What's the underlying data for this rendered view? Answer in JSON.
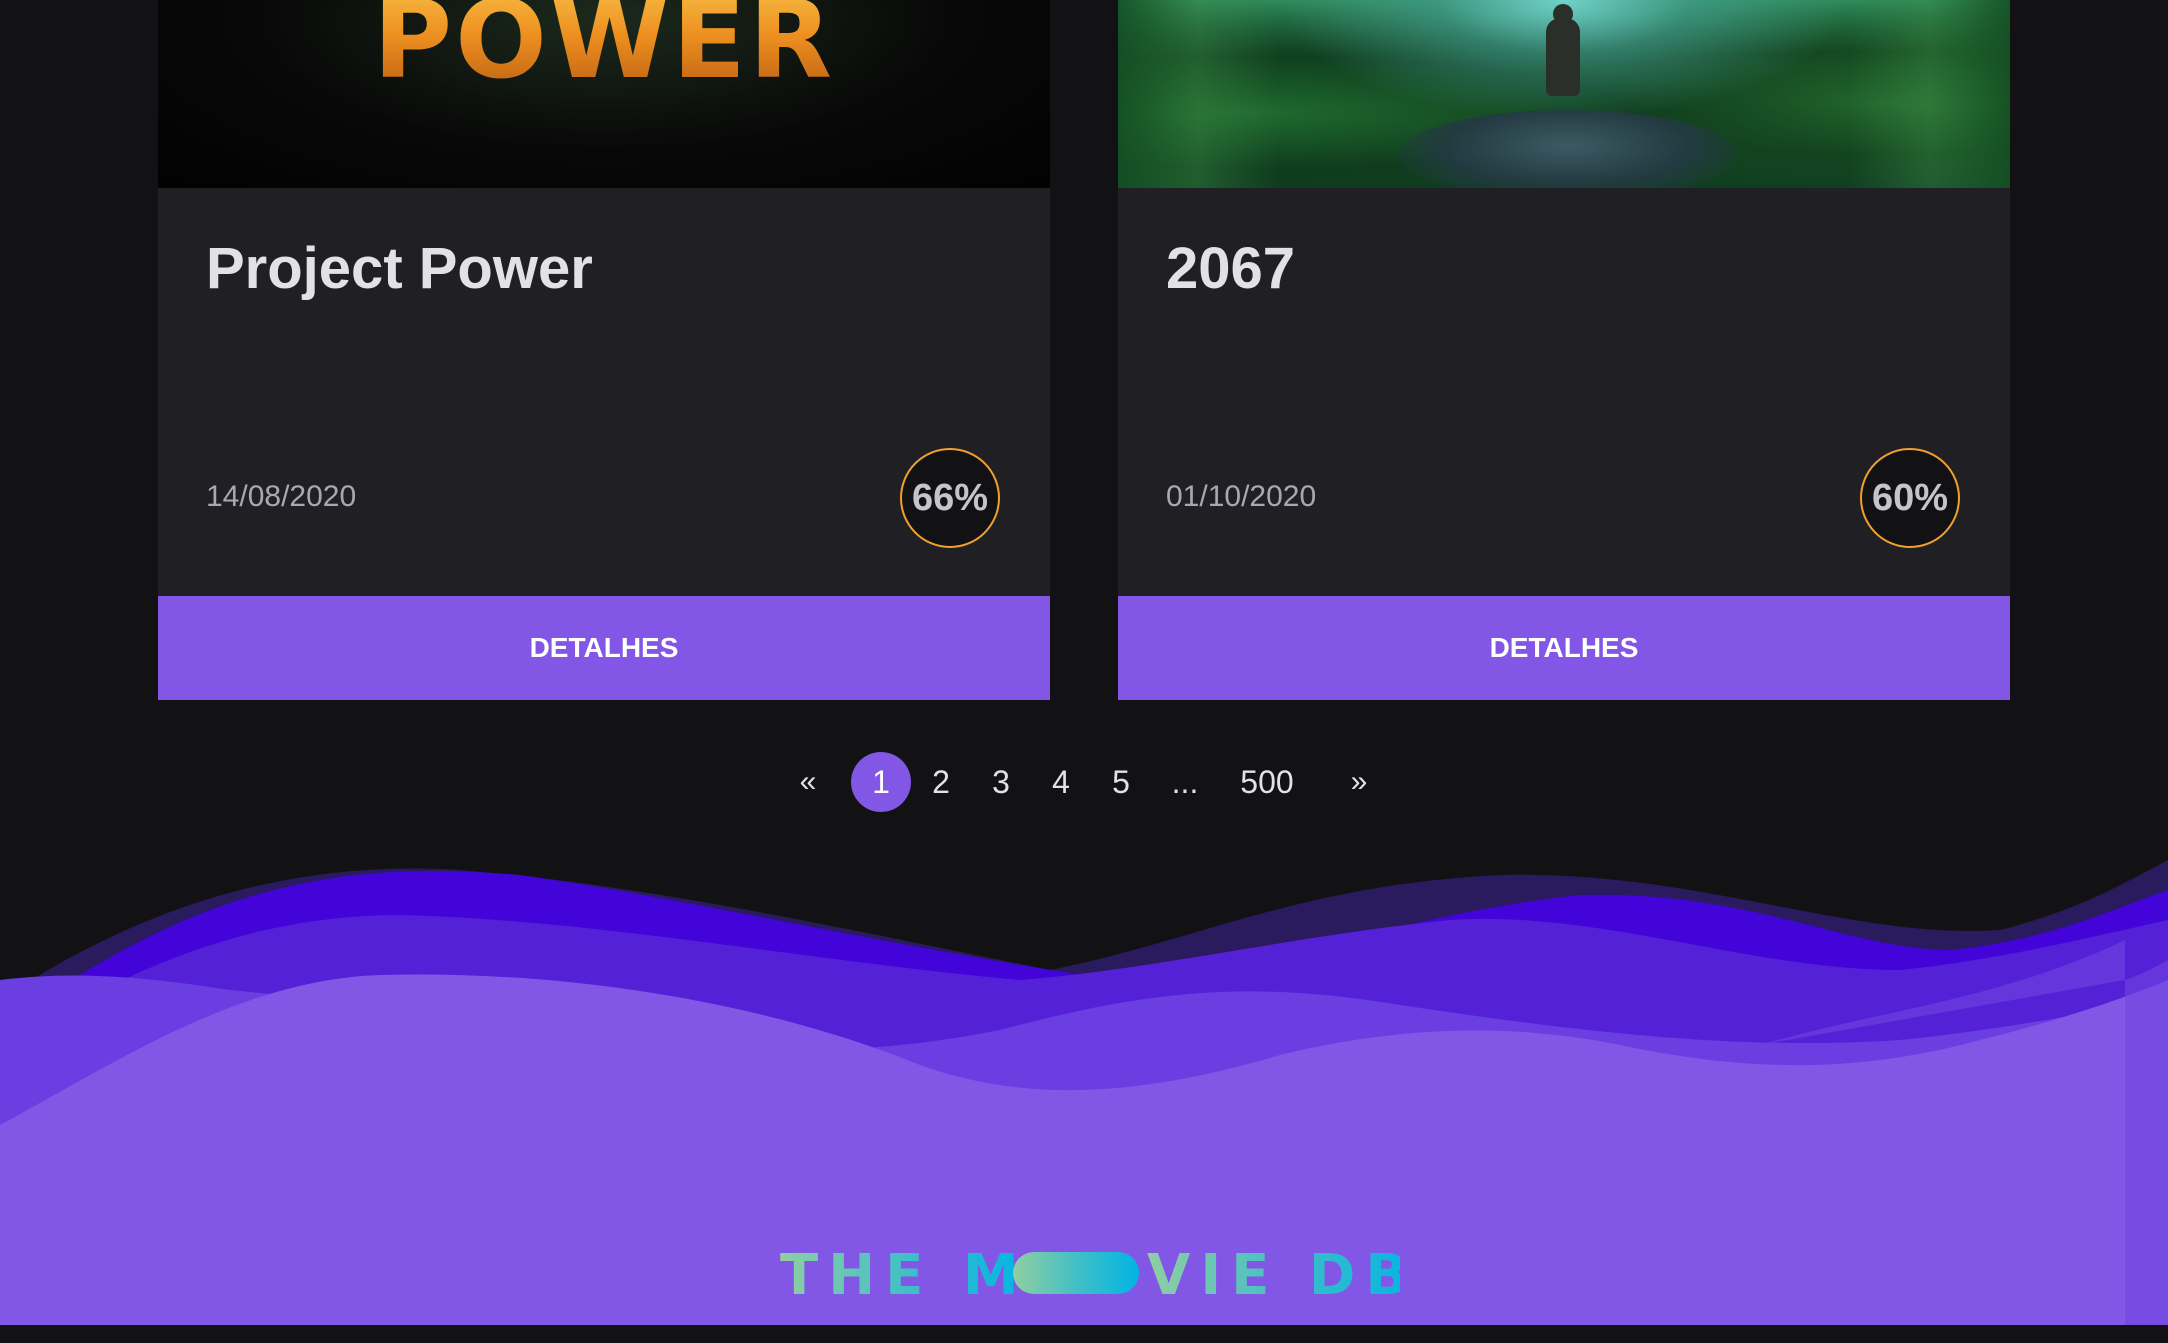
{
  "movies": [
    {
      "poster_text": "POWER",
      "title": "Project Power",
      "date": "14/08/2020",
      "score": "66%",
      "button_label": "DETALHES"
    },
    {
      "title": "2067",
      "date": "01/10/2020",
      "score": "60%",
      "button_label": "DETALHES"
    }
  ],
  "pagination": {
    "prev": "«",
    "pages": [
      "1",
      "2",
      "3",
      "4",
      "5"
    ],
    "ellipsis": "...",
    "last": "500",
    "next": "»",
    "current_page": "1"
  },
  "footer": {
    "logo_text": "THE MOVIE DB"
  },
  "colors": {
    "background": "#121214",
    "card": "#202024",
    "accent": "#8257e5",
    "score_ring": "#f2a02d",
    "logo_green": "#90cea1",
    "logo_blue": "#01b4e4"
  }
}
